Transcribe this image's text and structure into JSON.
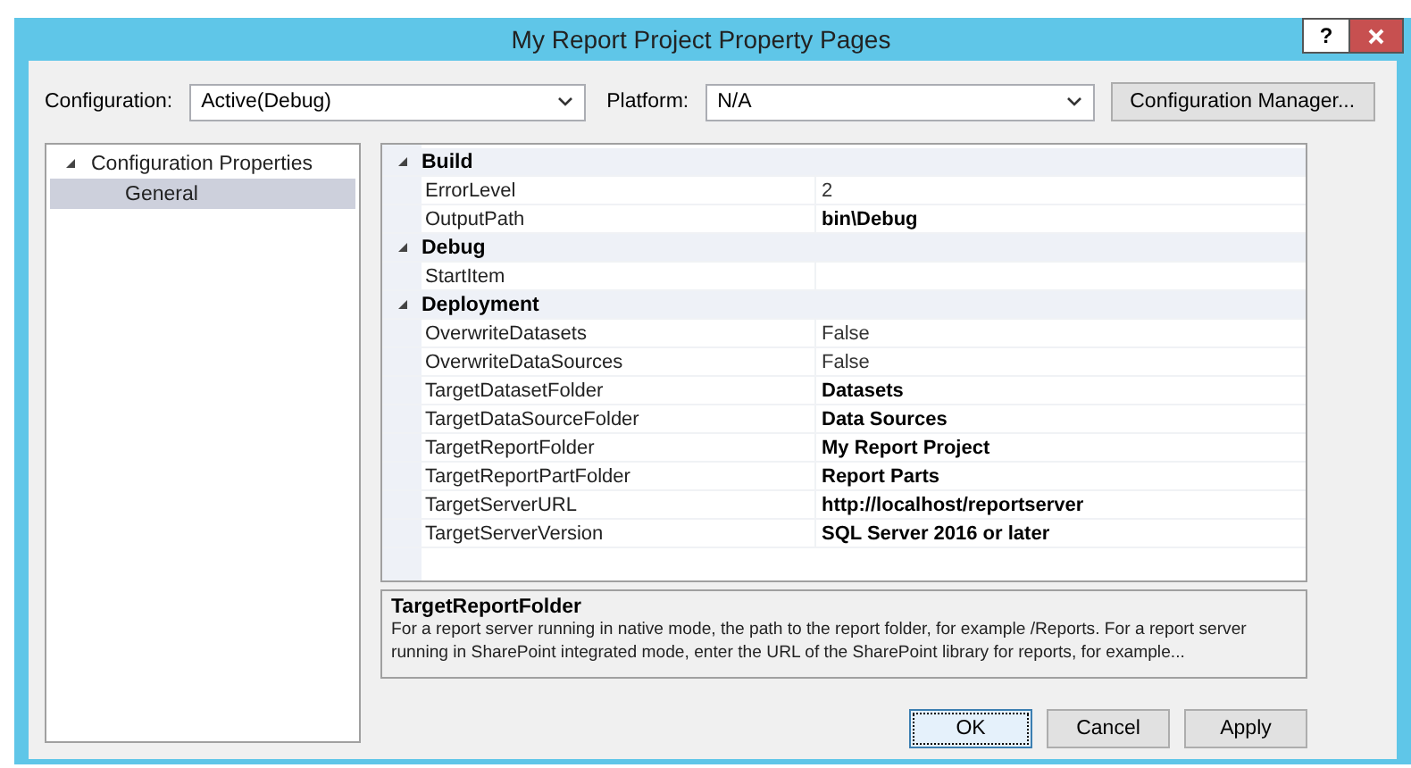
{
  "window": {
    "title": "My Report Project Property Pages",
    "help_button": "?"
  },
  "configuration": {
    "label": "Configuration:",
    "value": "Active(Debug)"
  },
  "platform": {
    "label": "Platform:",
    "value": "N/A"
  },
  "configuration_manager_button": "Configuration Manager...",
  "tree": [
    {
      "label": "Configuration Properties",
      "expanded": true,
      "selected": false,
      "children": [
        {
          "label": "General",
          "selected": true
        }
      ]
    }
  ],
  "property_grid": [
    {
      "category": "Build",
      "expanded": true,
      "properties": [
        {
          "name": "ErrorLevel",
          "value": "2",
          "bold": false
        },
        {
          "name": "OutputPath",
          "value": "bin\\Debug",
          "bold": true
        }
      ]
    },
    {
      "category": "Debug",
      "expanded": true,
      "properties": [
        {
          "name": "StartItem"
        }
      ]
    },
    {
      "category": "Deployment",
      "expanded": true,
      "properties": [
        {
          "name": "OverwriteDatasets",
          "value": "False",
          "bold": false
        },
        {
          "name": "OverwriteDataSources",
          "value": "False",
          "bold": false
        },
        {
          "name": "TargetDatasetFolder",
          "value": "Datasets",
          "bold": true
        },
        {
          "name": "TargetDataSourceFolder",
          "value": "Data Sources",
          "bold": true
        },
        {
          "name": "TargetReportFolder",
          "value": "My Report Project",
          "bold": true
        },
        {
          "name": "TargetReportPartFolder",
          "value": "Report Parts",
          "bold": true
        },
        {
          "name": "TargetServerURL",
          "value": "http://localhost/reportserver",
          "bold": true
        },
        {
          "name": "TargetServerVersion",
          "value": "SQL Server 2016 or later",
          "bold": true
        }
      ]
    }
  ],
  "description": {
    "title": "TargetReportFolder",
    "text": "For a report server running in native mode, the path to the report folder, for example /Reports. For a report server running in SharePoint integrated mode, enter the URL of the SharePoint library for reports, for example..."
  },
  "buttons": [
    {
      "label": "OK",
      "focused": true
    },
    {
      "label": "Cancel",
      "focused": false
    },
    {
      "label": "Apply",
      "focused": false
    }
  ]
}
